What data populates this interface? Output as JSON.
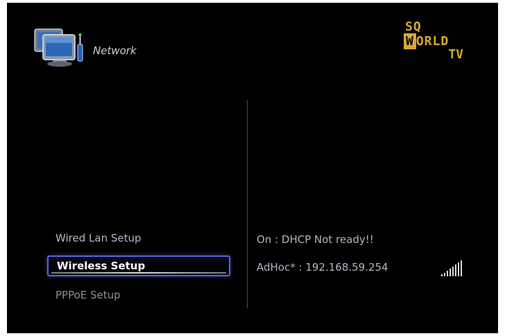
{
  "header": {
    "title": "Network",
    "icon": "network-computers-icon"
  },
  "logo": {
    "line1": "SQ",
    "line2_boxed": "W",
    "line2_rest": "ORLD",
    "line3": "TV",
    "color": "#d6a92e"
  },
  "menu": {
    "items": [
      {
        "label": "Wired Lan Setup",
        "selected": false
      },
      {
        "label": "Wireless Setup",
        "selected": true
      },
      {
        "label": "PPPoE Setup",
        "selected": false
      }
    ],
    "highlight_color": "#5563d9"
  },
  "status": {
    "line1": "On : DHCP Not ready!!",
    "line2": "AdHoc* : 192.168.59.254",
    "signal_icon": "signal-strength-icon"
  }
}
